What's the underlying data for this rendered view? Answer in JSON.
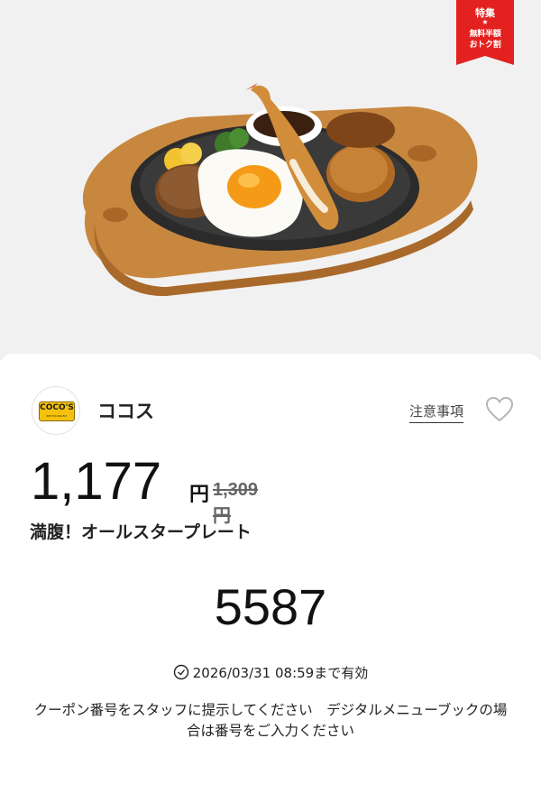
{
  "hero": {
    "ribbon": {
      "title": "特集",
      "star": "★",
      "line1": "無料半額",
      "line2": "おトク割",
      "color": "#e3211f"
    }
  },
  "shop": {
    "logo_text": "COCO'S",
    "logo_sub": "RESTAURANT",
    "name": "ココス"
  },
  "header_actions": {
    "notes_label": "注意事項"
  },
  "offer": {
    "price": "1,177",
    "currency": "円",
    "original_price": "1,309円",
    "item_name": "満腹！オールスタープレート",
    "coupon_code": "5587",
    "expiry": "2026/03/31 08:59まで有効",
    "instructions": "クーポン番号をスタッフに提示してください　デジタルメニューブックの場合は番号をご入力ください"
  },
  "icons": {
    "favorite": "heart-icon",
    "expiry": "clock-icon"
  }
}
